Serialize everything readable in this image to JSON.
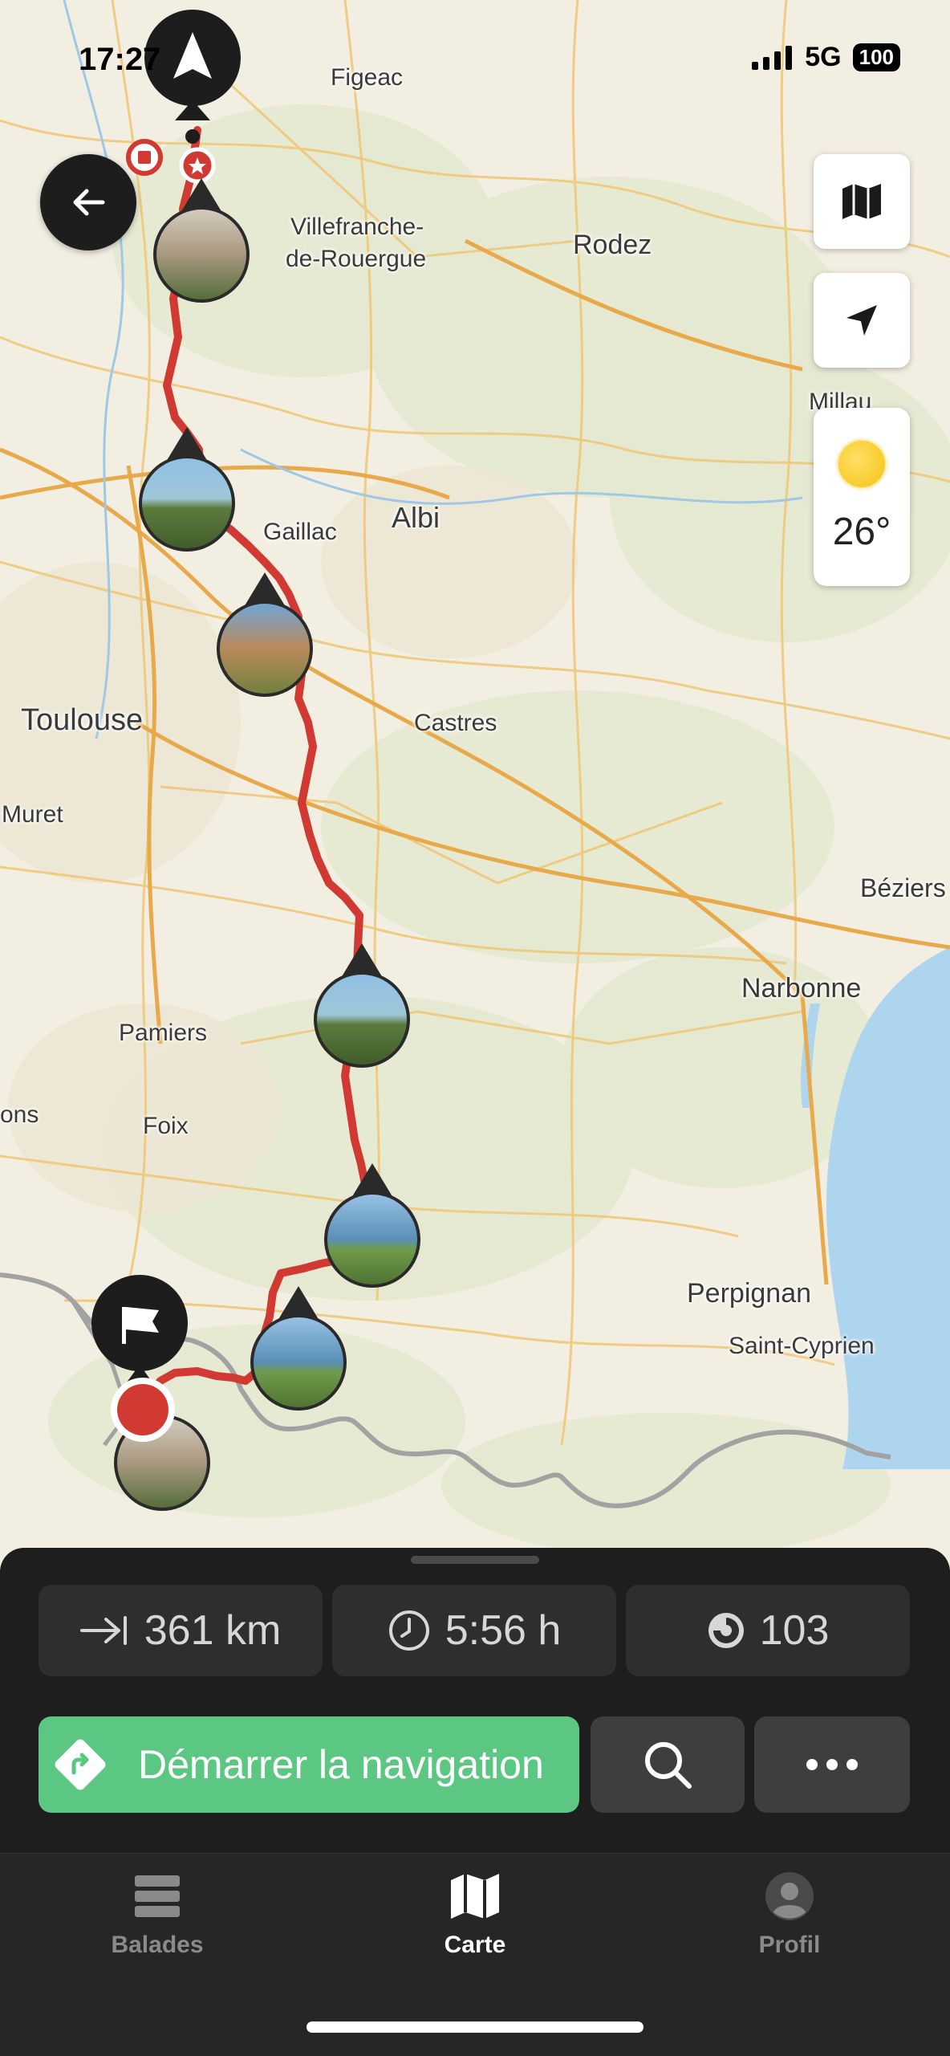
{
  "status_bar": {
    "time": "17:27",
    "network": "5G",
    "battery": "100"
  },
  "map": {
    "cities": [
      {
        "name": "Figeac",
        "size": 30
      },
      {
        "name": "Villefranche-",
        "size": 30
      },
      {
        "name": "de-Rouergue",
        "size": 30
      },
      {
        "name": "Rodez",
        "size": 34
      },
      {
        "name": "Millau",
        "size": 30
      },
      {
        "name": "Gaillac",
        "size": 30
      },
      {
        "name": "Albi",
        "size": 36
      },
      {
        "name": "Toulouse",
        "size": 38
      },
      {
        "name": "Castres",
        "size": 30
      },
      {
        "name": "Muret",
        "size": 30
      },
      {
        "name": "Béziers",
        "size": 32
      },
      {
        "name": "Narbonne",
        "size": 34
      },
      {
        "name": "Pamiers",
        "size": 30
      },
      {
        "name": "Foix",
        "size": 30
      },
      {
        "name": "ons",
        "size": 30
      },
      {
        "name": "Perpignan",
        "size": 34
      },
      {
        "name": "Saint-Cyprien",
        "size": 30
      }
    ],
    "route_color": "#d13a32",
    "border_color": "#9c9c9c",
    "sea_color": "#a9d3ec"
  },
  "map_controls": {
    "back_icon": "arrow-left-icon",
    "layers_icon": "map-icon",
    "locate_icon": "navigation-arrow-icon"
  },
  "weather": {
    "icon": "sun-icon",
    "temperature": "26°"
  },
  "route_summary": {
    "distance": "361 km",
    "duration": "5:56 h",
    "curviness": "103"
  },
  "actions": {
    "start_navigation": "Démarrer la navigation",
    "search_icon": "search-icon",
    "more_icon": "ellipsis-icon"
  },
  "tabs": [
    {
      "label": "Balades",
      "icon": "stack-icon",
      "active": false
    },
    {
      "label": "Carte",
      "icon": "map-icon",
      "active": true
    },
    {
      "label": "Profil",
      "icon": "user-icon",
      "active": false
    }
  ],
  "colors": {
    "accent_green": "#5bc783",
    "sheet_bg": "#1e1e1e",
    "tab_active": "#ffffff",
    "tab_inactive": "#8a8a8a"
  }
}
